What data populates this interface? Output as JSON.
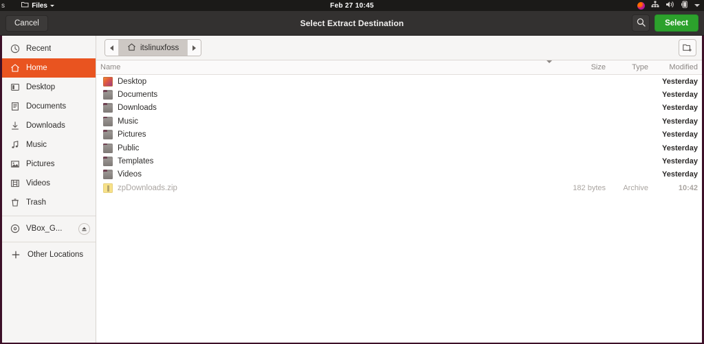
{
  "top_panel": {
    "activities_label": "s",
    "app_name": "Files",
    "app_icon": "folder-icon",
    "app_menu_caret": "chevron-down-icon",
    "clock": "Feb 27  10:45",
    "indicators": [
      {
        "name": "ubuntu-dot-icon"
      },
      {
        "name": "network-icon"
      },
      {
        "name": "volume-icon"
      },
      {
        "name": "battery-icon"
      },
      {
        "name": "chevron-down-icon"
      }
    ]
  },
  "headerbar": {
    "cancel_label": "Cancel",
    "title": "Select Extract Destination",
    "search_icon": "search-icon",
    "select_label": "Select",
    "select_color": "#2ca12c"
  },
  "sidebar": {
    "accent_color": "#e95420",
    "items": [
      {
        "label": "Recent",
        "icon": "clock-icon",
        "selected": false,
        "group": 1
      },
      {
        "label": "Home",
        "icon": "home-icon",
        "selected": true,
        "group": 1
      },
      {
        "label": "Desktop",
        "icon": "desktop-icon",
        "selected": false,
        "group": 1
      },
      {
        "label": "Documents",
        "icon": "document-icon",
        "selected": false,
        "group": 1
      },
      {
        "label": "Downloads",
        "icon": "download-icon",
        "selected": false,
        "group": 1
      },
      {
        "label": "Music",
        "icon": "music-note-icon",
        "selected": false,
        "group": 1
      },
      {
        "label": "Pictures",
        "icon": "image-icon",
        "selected": false,
        "group": 1
      },
      {
        "label": "Videos",
        "icon": "film-icon",
        "selected": false,
        "group": 1
      },
      {
        "label": "Trash",
        "icon": "trash-icon",
        "selected": false,
        "group": 1
      },
      {
        "label": "VBox_G...",
        "icon": "disc-icon",
        "selected": false,
        "group": 2,
        "eject": true
      },
      {
        "label": "Other Locations",
        "icon": "plus-icon",
        "selected": false,
        "group": 3
      }
    ]
  },
  "pathbar": {
    "back_icon": "triangle-left-icon",
    "forward_icon": "triangle-right-icon",
    "crumb_icon": "home-icon",
    "crumb_label": "itslinuxfoss",
    "new_folder_icon": "new-folder-icon"
  },
  "columns": {
    "name": "Name",
    "size": "Size",
    "type": "Type",
    "modified": "Modified",
    "sort_icon": "triangle-down-icon"
  },
  "files": [
    {
      "name": "Desktop",
      "icon": "desktop-thumbnail-icon",
      "size": "",
      "type": "",
      "modified": "Yesterday",
      "dim": false
    },
    {
      "name": "Documents",
      "icon": "folder-icon",
      "size": "",
      "type": "",
      "modified": "Yesterday",
      "dim": false
    },
    {
      "name": "Downloads",
      "icon": "folder-icon",
      "size": "",
      "type": "",
      "modified": "Yesterday",
      "dim": false
    },
    {
      "name": "Music",
      "icon": "folder-icon",
      "size": "",
      "type": "",
      "modified": "Yesterday",
      "dim": false
    },
    {
      "name": "Pictures",
      "icon": "folder-icon",
      "size": "",
      "type": "",
      "modified": "Yesterday",
      "dim": false
    },
    {
      "name": "Public",
      "icon": "folder-icon",
      "size": "",
      "type": "",
      "modified": "Yesterday",
      "dim": false
    },
    {
      "name": "Templates",
      "icon": "folder-icon",
      "size": "",
      "type": "",
      "modified": "Yesterday",
      "dim": false
    },
    {
      "name": "Videos",
      "icon": "folder-icon",
      "size": "",
      "type": "",
      "modified": "Yesterday",
      "dim": false
    },
    {
      "name": "zpDownloads.zip",
      "icon": "zip-icon",
      "size": "182 bytes",
      "type": "Archive",
      "modified": "10:42",
      "dim": true
    }
  ]
}
